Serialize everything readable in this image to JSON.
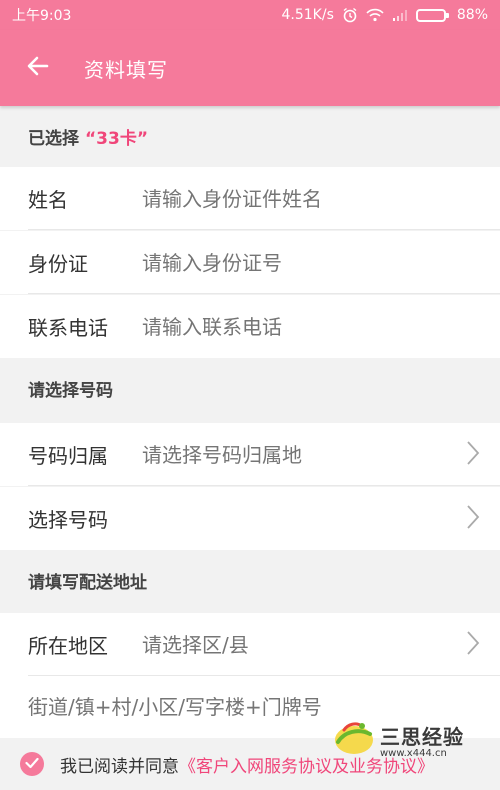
{
  "status_bar": {
    "time": "上午9:03",
    "net_speed": "4.51K/s",
    "battery_pct": "88%",
    "battery_level": 0.88
  },
  "app_bar": {
    "title": "资料填写"
  },
  "selected": {
    "prefix": "已选择",
    "card": "“33卡”"
  },
  "personal": {
    "name_label": "姓名",
    "name_placeholder": "请输入身份证件姓名",
    "id_label": "身份证",
    "id_placeholder": "请输入身份证号",
    "phone_label": "联系电话",
    "phone_placeholder": "请输入联系电话"
  },
  "number_section": {
    "header": "请选择号码",
    "region_label": "号码归属",
    "region_placeholder": "请选择号码归属地",
    "number_label": "选择号码"
  },
  "address_section": {
    "header": "请填写配送地址",
    "area_label": "所在地区",
    "area_placeholder": "请选择区/县",
    "street_placeholder": "街道/镇+村/小区/写字楼+门牌号"
  },
  "agreement": {
    "text": "我已阅读并同意",
    "link": "《客户入网服务协议及业务协议》"
  },
  "watermark": {
    "name": "三思经验",
    "url": "www.x444.cn"
  },
  "colors": {
    "accent": "#f57a9b",
    "link": "#f0467a"
  }
}
